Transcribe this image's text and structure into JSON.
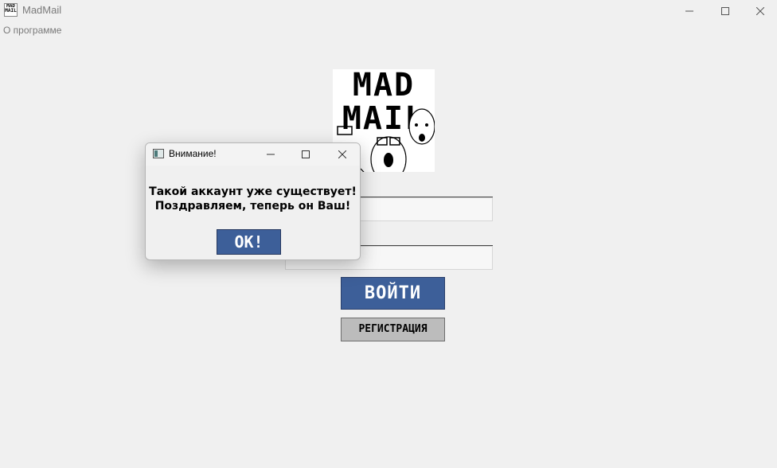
{
  "window": {
    "title": "MadMail",
    "icon_name": "madmail-app-icon"
  },
  "menu": {
    "items": [
      "О программе"
    ]
  },
  "logo": {
    "line1": "MAD",
    "line2": "MAIL"
  },
  "form": {
    "login_value": "",
    "password_value": ""
  },
  "buttons": {
    "login_label": "ВОЙТИ",
    "register_label": "РЕГИСТРАЦИЯ"
  },
  "dialog": {
    "title": "Внимание!",
    "message_line1": "Такой аккаунт уже существует!",
    "message_line2": "Поздравляем, теперь он Ваш!",
    "ok_label": "ОК!"
  },
  "colors": {
    "background": "#f0f0f0",
    "primary_button": "#3d5f99",
    "secondary_button": "#bcbcbc"
  }
}
